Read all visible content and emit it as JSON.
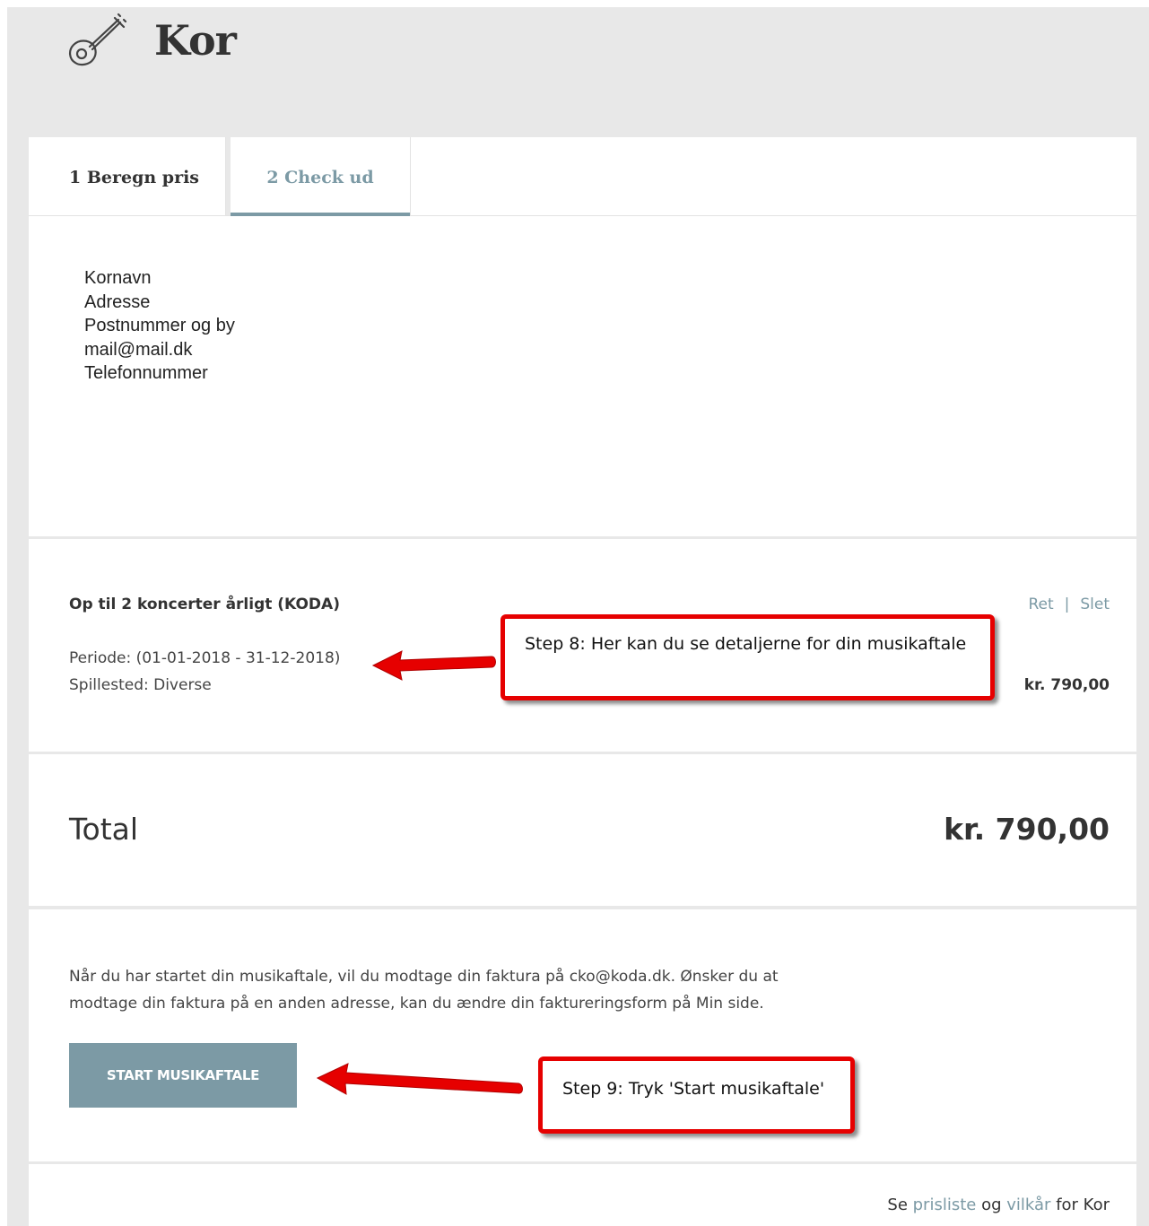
{
  "header": {
    "title": "Kor",
    "icon": "guitar-icon"
  },
  "tabs": [
    {
      "label": "1 Beregn pris",
      "active": false
    },
    {
      "label": "2 Check ud",
      "active": true
    }
  ],
  "address": {
    "lines": [
      "Kornavn",
      "Adresse",
      "Postnummer og by",
      "mail@mail.dk",
      "Telefonnummer"
    ]
  },
  "item": {
    "title": "Op til 2 koncerter årligt (KODA)",
    "period": "Periode: (01-01-2018 - 31-12-2018)",
    "venue": "Spillested: Diverse",
    "edit_label": "Ret",
    "separator": "|",
    "delete_label": "Slet",
    "price": "kr. 790,00"
  },
  "total": {
    "label": "Total",
    "value": "kr. 790,00"
  },
  "checkout": {
    "info_text": "Når du har startet din musikaftale, vil du modtage din faktura på cko@koda.dk. Ønsker du at modtage din faktura på en anden adresse, kan du ændre din faktureringsform på Min side.",
    "start_button": "START MUSIKAFTALE"
  },
  "footer": {
    "prefix": "Se",
    "pricelist_link": "prisliste",
    "and": "og",
    "terms_link": "vilkår",
    "suffix": "for Kor"
  },
  "annotations": {
    "step8": "Step 8: Her kan du se detaljerne for din musikaftale",
    "step9": "Step 9: Tryk 'Start musikaftale'",
    "arrow_color": "#e60000"
  },
  "colors": {
    "accent": "#7c9aa5",
    "background": "#e8e8e8",
    "card": "#ffffff"
  }
}
